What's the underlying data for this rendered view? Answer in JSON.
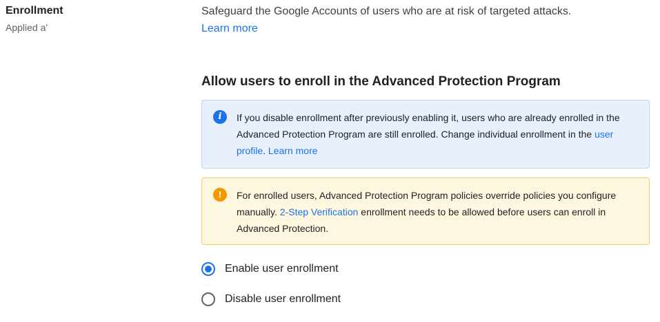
{
  "left": {
    "title": "Enrollment",
    "subtitle": "Applied a'"
  },
  "description": {
    "text": "Safeguard the Google Accounts of users who are at risk of targeted attacks.",
    "learn_more": "Learn more"
  },
  "section_title": "Allow users to enroll in the Advanced Protection Program",
  "info_box": {
    "icon": "info-icon",
    "text_1": "If you disable enrollment after previously enabling it, users who are already enrolled in the Advanced Protection Program are still enrolled. Change individual enrollment in the ",
    "link_user_profile": "user profile",
    "text_2": ". ",
    "learn_more": "Learn more"
  },
  "warning_box": {
    "icon": "warning-icon",
    "text_1": "For enrolled users, Advanced Protection Program policies override policies you configure manually. ",
    "link_2sv": "2-Step Verification",
    "text_2": " enrollment needs to be allowed before users can enroll in Advanced Protection."
  },
  "options": {
    "enable": {
      "label": "Enable user enrollment",
      "selected": true
    },
    "disable": {
      "label": "Disable user enrollment",
      "selected": false
    }
  },
  "colors": {
    "accent": "#1a73e8",
    "info_bg": "#e8f0fe",
    "warn_bg": "#fef7e0",
    "warn_icon": "#f29900"
  }
}
